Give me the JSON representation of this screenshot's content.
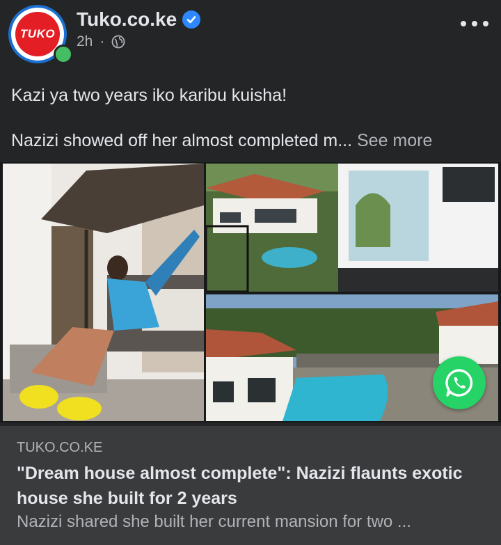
{
  "post": {
    "page_name": "Tuko.co.ke",
    "avatar_text": "TUKO",
    "time": "2h",
    "separator": "·",
    "text_line1": "Kazi ya two years iko karibu kuisha!",
    "text_line2": "Nazizi showed off her almost completed m...",
    "see_more": "See more"
  },
  "link": {
    "domain": "TUKO.CO.KE",
    "title": "\"Dream house almost complete\": Nazizi flaunts exotic house she built for 2 years",
    "description": "Nazizi shared she built her current mansion for two ..."
  },
  "icons": {
    "verified": "verified-badge-icon",
    "audience": "globe-icon",
    "menu": "more-options-icon",
    "share": "whatsapp-icon"
  },
  "colors": {
    "background": "#242526",
    "card": "#3a3b3c",
    "verified": "#2d88ff",
    "whatsapp": "#25d366",
    "brand": "#e31e24"
  }
}
